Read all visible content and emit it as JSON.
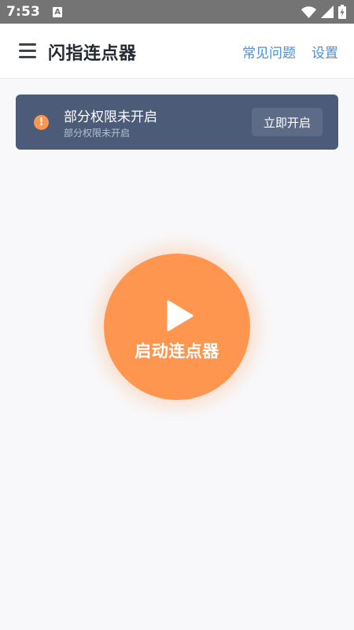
{
  "status_bar": {
    "time": "7:53",
    "app_icon_letter": "A",
    "icons": [
      "wifi-icon",
      "signal-icon",
      "battery-charging-icon"
    ]
  },
  "app_bar": {
    "title": "闪指连点器",
    "faq_label": "常见问题",
    "settings_label": "设置",
    "menu_icon": "hamburger-menu-icon"
  },
  "banner": {
    "alert_symbol": "!",
    "title": "部分权限未开启",
    "subtitle": "部分权限未开启",
    "button_label": "立即开启"
  },
  "start": {
    "label": "启动连点器",
    "icon": "play-icon"
  },
  "colors": {
    "status_bar_bg": "#747474",
    "accent_orange": "#ff964f",
    "banner_bg": "#4c5b77",
    "link_blue": "#4b8fd8",
    "page_bg": "#f8f8fa"
  }
}
